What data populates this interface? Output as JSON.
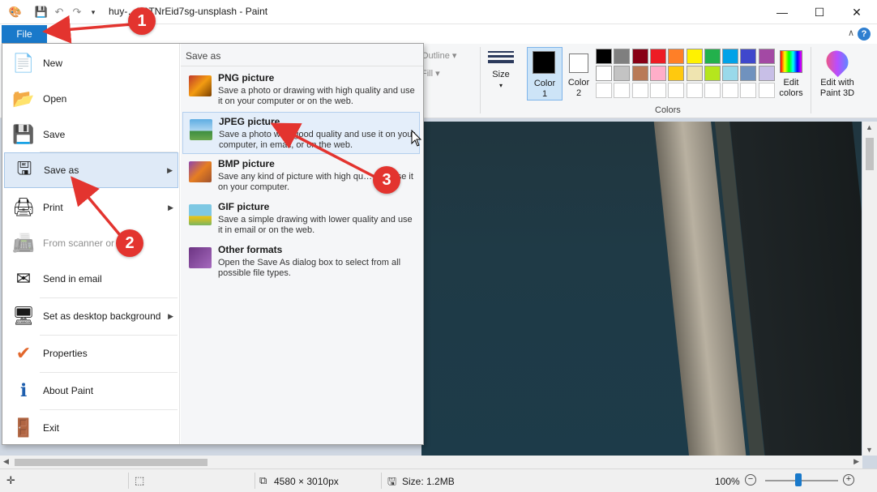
{
  "window": {
    "title": "huy-…T8TNrEid7sg-unsplash - Paint",
    "controls": [
      "—",
      "☐",
      "✕"
    ]
  },
  "ribbon": {
    "file_tab": "File",
    "outline": "Outline",
    "fill": "Fill",
    "size": "Size",
    "color1": "Color\n1",
    "color2": "Color\n2",
    "colors_group": "Colors",
    "edit_colors": "Edit\ncolors",
    "edit_paint3d": "Edit with\nPaint 3D",
    "palette_row1": [
      "#000000",
      "#7f7f7f",
      "#880015",
      "#ed1c24",
      "#ff7f27",
      "#fff200",
      "#22b14c",
      "#00a2e8",
      "#3f48cc",
      "#a349a4"
    ],
    "palette_row2": [
      "#ffffff",
      "#c3c3c3",
      "#b97a57",
      "#ffaec9",
      "#ffc90e",
      "#efe4b0",
      "#b5e61d",
      "#99d9ea",
      "#7092be",
      "#c8bfe7"
    ],
    "palette_row3_empty": 10
  },
  "file_menu": {
    "items": [
      {
        "label": "New",
        "icon": "new-document-icon"
      },
      {
        "label": "Open",
        "icon": "open-folder-icon"
      },
      {
        "label": "Save",
        "icon": "save-disk-icon"
      },
      {
        "label": "Save as",
        "icon": "save-as-icon",
        "submenu": true,
        "active": true
      },
      {
        "label": "Print",
        "icon": "printer-icon",
        "submenu": true
      },
      {
        "label": "From scanner or c",
        "icon": "scanner-icon",
        "disabled": true
      },
      {
        "label": "Send in email",
        "icon": "email-icon"
      },
      {
        "label": "Set as desktop background",
        "icon": "desktop-icon",
        "submenu": true
      },
      {
        "label": "Properties",
        "icon": "checkmark-icon"
      },
      {
        "label": "About Paint",
        "icon": "info-icon"
      },
      {
        "label": "Exit",
        "icon": "exit-icon"
      }
    ],
    "save_as": {
      "header": "Save as",
      "options": [
        {
          "name": "PNG picture",
          "desc": "Save a photo or drawing with high quality and use it on your computer or on the web."
        },
        {
          "name": "JPEG picture",
          "desc": "Save a photo wi… good quality and use it on your computer, in email, or on the web.",
          "active": true
        },
        {
          "name": "BMP picture",
          "desc": "Save any kind of picture with high qu… and use it on your computer."
        },
        {
          "name": "GIF picture",
          "desc": "Save a simple drawing with lower quality and use it in email or on the web."
        },
        {
          "name": "Other formats",
          "desc": "Open the Save As dialog box to select from all possible file types."
        }
      ]
    }
  },
  "status": {
    "dimensions": "4580 × 3010px",
    "size": "Size: 1.2MB",
    "zoom": "100%",
    "zoom_level": 0.45
  },
  "annotations": [
    "1",
    "2",
    "3"
  ],
  "colors": {
    "accent": "#1979ca",
    "annotation": "#e3342f"
  }
}
